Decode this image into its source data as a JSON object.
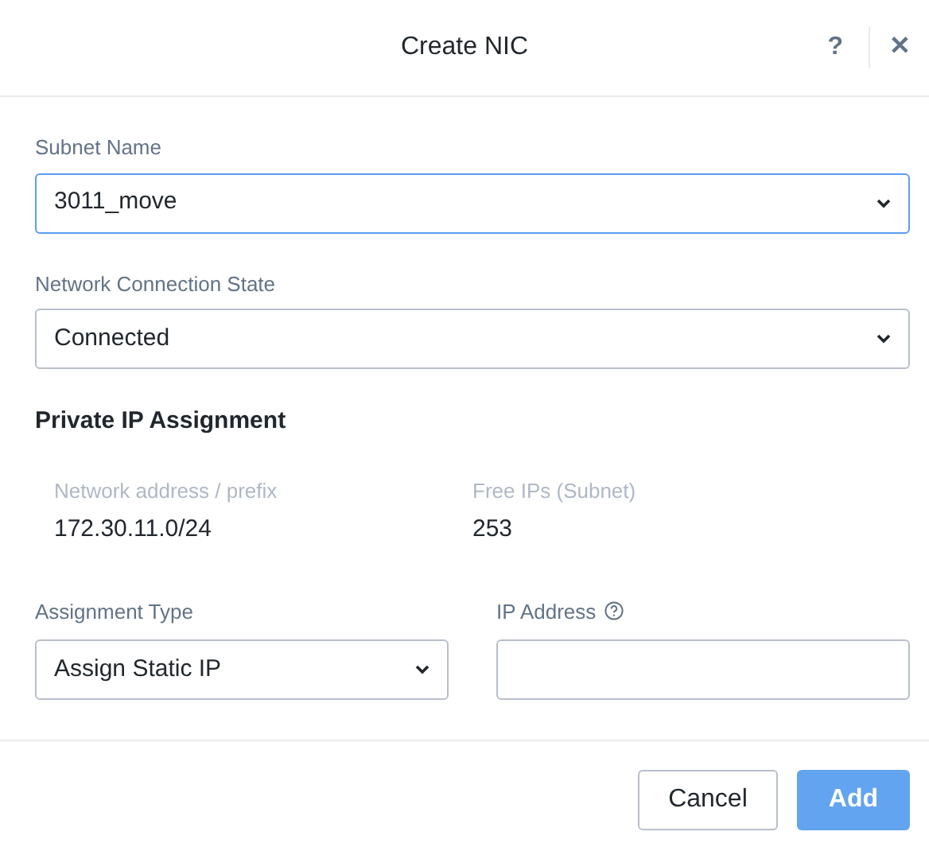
{
  "dialog": {
    "title": "Create NIC",
    "help": "?",
    "close": "✕"
  },
  "fields": [
    {
      "label": "Subnet Name",
      "value": "3011_move",
      "focused": true
    },
    {
      "label": "Network Connection State",
      "value": "Connected",
      "focused": false
    }
  ],
  "section": {
    "title": "Private IP Assignment",
    "info": [
      {
        "label": "Network address / prefix",
        "value": "172.30.11.0/24"
      },
      {
        "label": "Free IPs (Subnet)",
        "value": "253"
      }
    ]
  },
  "assignment_type": {
    "label": "Assignment Type",
    "value": "Assign Static IP"
  },
  "ip_address": {
    "label": "IP Address"
  },
  "buttons": [
    {
      "label": "Cancel",
      "kind": "secondary",
      "disabled": false
    },
    {
      "label": "Add",
      "kind": "primary",
      "disabled": true
    }
  ]
}
